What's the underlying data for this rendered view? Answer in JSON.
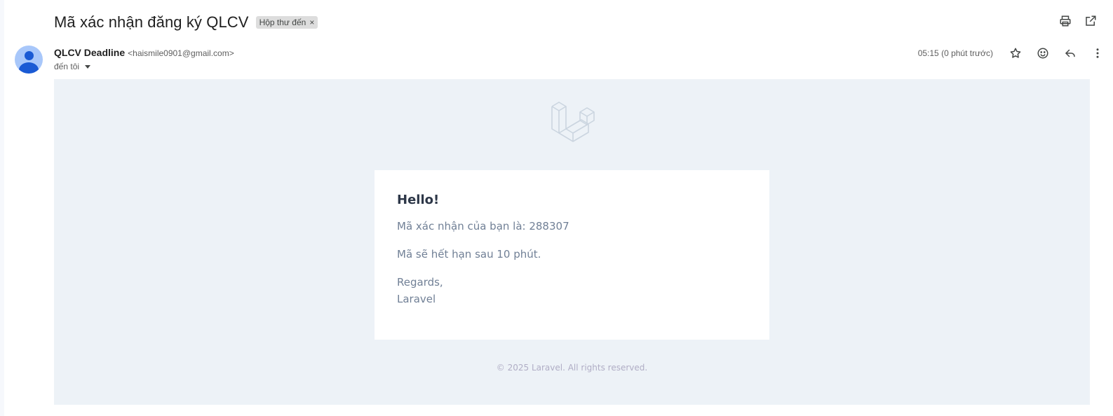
{
  "email": {
    "subject": "Mã xác nhận đăng ký QLCV",
    "label_chip": "Hộp thư đến",
    "label_remove": "×",
    "sender_name": "QLCV Deadline",
    "sender_email": "<haismile0901@gmail.com>",
    "recipient": "đến tôi",
    "timestamp": "05:15 (0 phút trước)"
  },
  "icons": {
    "print": "printer-icon",
    "open_new_window": "open-in-new-icon",
    "star": "star-icon",
    "emoji": "emoji-icon",
    "reply": "reply-icon",
    "more": "more-vert-icon",
    "avatar": "person-avatar",
    "logo": "laravel-logo"
  },
  "body": {
    "greeting": "Hello!",
    "line1": "Mã xác nhận của bạn là: 288307",
    "line2": "Mã sẽ hết hạn sau 10 phút.",
    "regards": "Regards,",
    "signature": "Laravel",
    "footer": "© 2025 Laravel. All rights reserved."
  },
  "colors": {
    "frame_bg": "#edf2f7",
    "card_bg": "#ffffff",
    "heading": "#2d3748",
    "text": "#718096",
    "footer_text": "#b0adc5",
    "avatar_bg": "#a8c7fa",
    "avatar_fg": "#1a5ad4"
  }
}
